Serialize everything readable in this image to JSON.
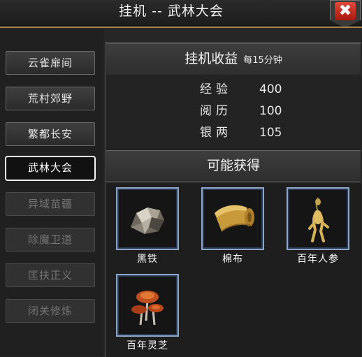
{
  "window": {
    "title": "挂机 --    武林大会",
    "close_label": "✖"
  },
  "sidebar": {
    "items": [
      {
        "label": "云雀扉间",
        "state": "normal"
      },
      {
        "label": "荒村郊野",
        "state": "normal"
      },
      {
        "label": "繁都长安",
        "state": "normal"
      },
      {
        "label": "武林大会",
        "state": "selected"
      },
      {
        "label": "异域苗疆",
        "state": "disabled"
      },
      {
        "label": "除魔卫道",
        "state": "disabled"
      },
      {
        "label": "匡扶正义",
        "state": "disabled"
      },
      {
        "label": "闭关修炼",
        "state": "disabled"
      }
    ]
  },
  "earnings": {
    "title": "挂机收益",
    "interval": "每15分钟",
    "stats": [
      {
        "label": "经验",
        "value": "400"
      },
      {
        "label": "阅历",
        "value": "100"
      },
      {
        "label": "银两",
        "value": "105"
      }
    ]
  },
  "rewards": {
    "title": "可能获得",
    "items": [
      {
        "name": "黑铁",
        "icon": "black-iron-ore-icon"
      },
      {
        "name": "棉布",
        "icon": "cotton-cloth-icon"
      },
      {
        "name": "百年人参",
        "icon": "ginseng-root-icon"
      },
      {
        "name": "百年灵芝",
        "icon": "lingzhi-mushroom-icon"
      }
    ]
  },
  "colors": {
    "accent_gold": "#a37f4a",
    "slot_border": "#8ea7c9",
    "close_red": "#c0281b"
  }
}
